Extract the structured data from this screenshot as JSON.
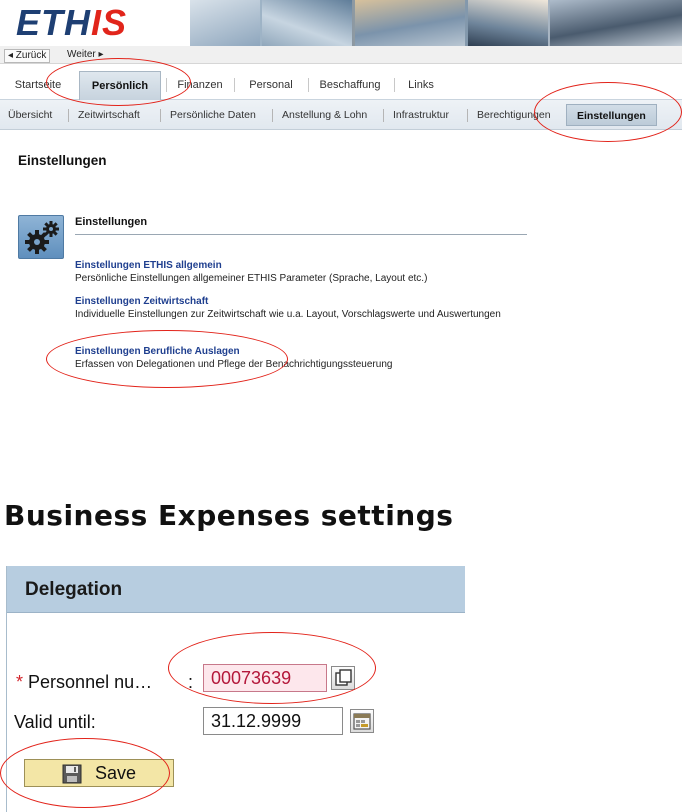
{
  "banner": {
    "logo_prefix": "ETH",
    "logo_suffix": "IS"
  },
  "navbar": {
    "back_label": "◂ Zurück",
    "forward_label": "Weiter ▸"
  },
  "main_tabs": [
    {
      "label": "Startseite",
      "active": false
    },
    {
      "label": "Persönlich",
      "active": true
    },
    {
      "label": "Finanzen",
      "active": false
    },
    {
      "label": "Personal",
      "active": false
    },
    {
      "label": "Beschaffung",
      "active": false
    },
    {
      "label": "Links",
      "active": false
    }
  ],
  "sub_tabs": [
    {
      "label": "Übersicht",
      "active": false
    },
    {
      "label": "Zeitwirtschaft",
      "active": false
    },
    {
      "label": "Persönliche Daten",
      "active": false
    },
    {
      "label": "Anstellung & Lohn",
      "active": false
    },
    {
      "label": "Infrastruktur",
      "active": false
    },
    {
      "label": "Berechtigungen",
      "active": false
    },
    {
      "label": "Einstellungen",
      "active": true
    }
  ],
  "page": {
    "title": "Einstellungen",
    "section_heading": "Einstellungen",
    "links": [
      {
        "title": "Einstellungen ETHIS allgemein",
        "description": "Persönliche Einstellungen allgemeiner ETHIS Parameter (Sprache, Layout etc.)"
      },
      {
        "title": "Einstellungen Zeitwirtschaft",
        "description": "Individuelle Einstellungen zur Zeitwirtschaft wie u.a. Layout, Vorschlagswerte und Auswertungen"
      },
      {
        "title": "Einstellungen Berufliche Auslagen",
        "description": "Erfassen von Delegationen und Pflege der  Benachrichtigungssteuerung"
      }
    ]
  },
  "expenses": {
    "title": "Business Expenses settings",
    "panel_title": "Delegation",
    "required_marker": "*",
    "personnel_label": "Personnel nu…",
    "personnel_colon": ":",
    "personnel_value": "00073639",
    "valid_until_label": "Valid until:",
    "valid_until_value": "31.12.9999",
    "save_label": "Save"
  },
  "colors": {
    "annotation_ring": "#e2231a",
    "link_blue": "#1f3f8f",
    "required_field_bg": "#fde7ec",
    "save_button_bg": "#f3e6a6",
    "panel_header_bg": "#b7cde0"
  },
  "icons": [
    "gears-icon",
    "value-help-icon",
    "calendar-icon",
    "floppy-disk-icon"
  ]
}
